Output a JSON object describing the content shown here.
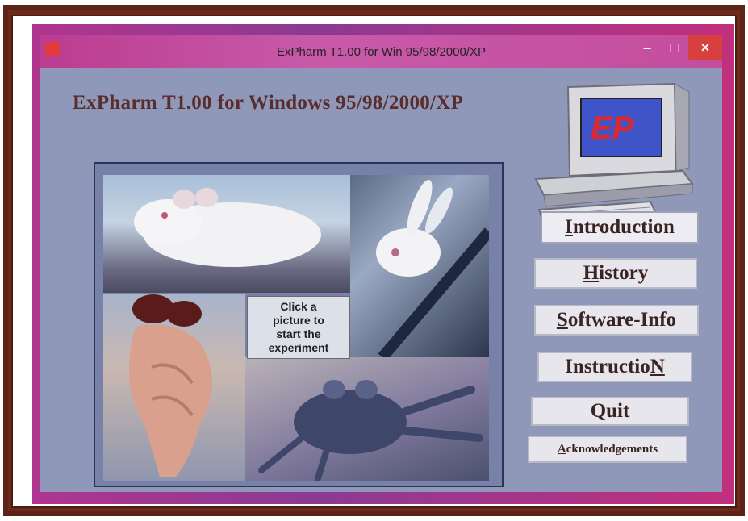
{
  "window": {
    "title": "ExPharm T1.00 for Win 95/98/2000/XP",
    "minimize": "–",
    "maximize": "□",
    "close": "×"
  },
  "app": {
    "heading": "ExPharm T1.00 for Windows 95/98/2000/XP",
    "logo_text": "EP"
  },
  "collage": {
    "prompt_line1": "Click a",
    "prompt_line2": "picture to",
    "prompt_line3": "start the",
    "prompt_line4": "experiment",
    "pictures": [
      "mouse",
      "rabbit",
      "isolated-organ",
      "frog"
    ]
  },
  "menu": {
    "introduction": {
      "accel": "I",
      "rest": "ntroduction"
    },
    "history": {
      "accel": "H",
      "rest": "istory"
    },
    "software_info": {
      "accel": "S",
      "rest": "oftware-Info"
    },
    "instruction": {
      "pre": "Instructio",
      "accel": "N"
    },
    "quit": "Quit",
    "acknowledgements": {
      "accel": "A",
      "rest": "cknowledgements"
    }
  },
  "colors": {
    "window_bg": "#8f98b8",
    "titlebar": "#c44d9e",
    "heading_text": "#5a2c2c",
    "frame": "#5b2417"
  }
}
